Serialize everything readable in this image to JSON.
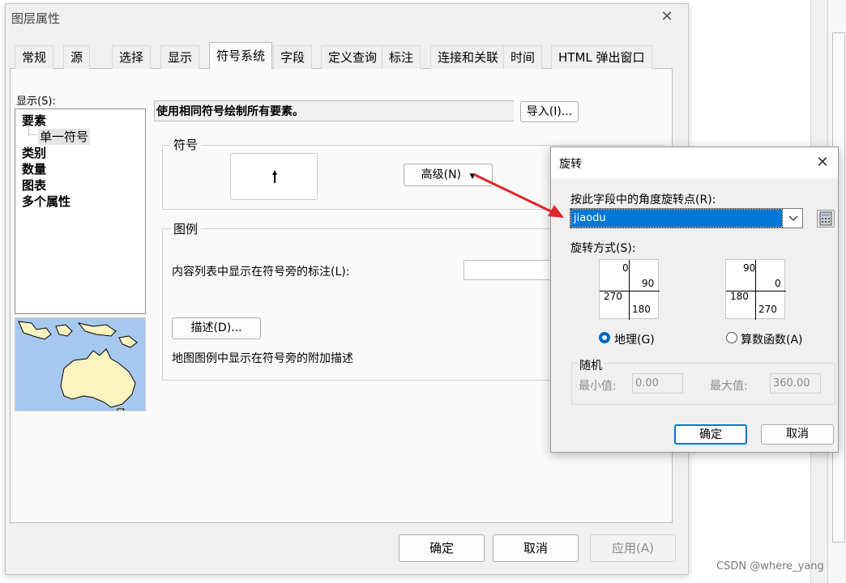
{
  "main_dialog": {
    "title": "图层属性",
    "close": "✕",
    "tabs": [
      {
        "label": "常规"
      },
      {
        "label": "源"
      },
      {
        "label": "选择"
      },
      {
        "label": "显示"
      },
      {
        "label": "符号系统",
        "active": true
      },
      {
        "label": "字段"
      },
      {
        "label": "定义查询"
      },
      {
        "label": "标注"
      },
      {
        "label": "连接和关联"
      },
      {
        "label": "时间"
      },
      {
        "label": "HTML 弹出窗口"
      }
    ],
    "show_label": "显示(S):",
    "tree": {
      "items": [
        "要素",
        "类别",
        "数量",
        "图表",
        "多个属性"
      ],
      "sub_item": "单一符号"
    },
    "description": "使用相同符号绘制所有要素。",
    "import_button": "导入(I)...",
    "symbol_group_label": "符号",
    "advanced_button": "高级(N)",
    "legend_group_label": "图例",
    "legend_toc_label": "内容列表中显示在符号旁的标注(L):",
    "describe_button": "描述(D)...",
    "legend_note": "地图图例中显示在符号旁的附加描述",
    "ok_button": "确定",
    "cancel_button": "取消",
    "apply_button": "应用(A)"
  },
  "rotation_dialog": {
    "title": "旋转",
    "close": "✕",
    "field_label": "按此字段中的角度旋转点(R):",
    "field_value": "jiaodu",
    "mode_label": "旋转方式(S):",
    "geographic": {
      "top": "0",
      "right": "90",
      "bottom": "180",
      "left": "270",
      "label": "地理(G)",
      "selected": true
    },
    "arithmetic": {
      "top": "90",
      "right": "0",
      "bottom": "270",
      "left": "180",
      "label": "算数函数(A)",
      "selected": false
    },
    "random_label": "随机",
    "min_label": "最小值:",
    "min_value": "0.00",
    "max_label": "最大值:",
    "max_value": "360.00",
    "ok_button": "确定",
    "cancel_button": "取消"
  },
  "watermark": "CSDN @where_yang",
  "colors": {
    "accent": "#0078d7",
    "annotation_arrow": "#e0262a",
    "map_water": "#a6c8ef",
    "map_land": "#fbf3c0"
  }
}
